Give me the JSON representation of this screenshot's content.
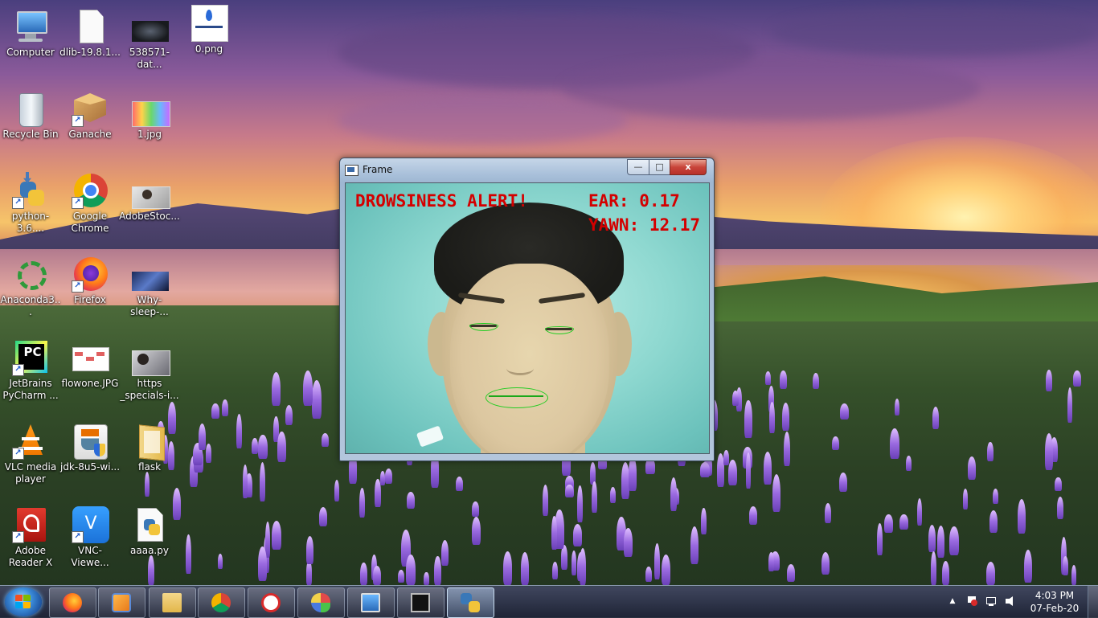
{
  "desktop": {
    "icons": [
      {
        "label": "Computer",
        "icon": "computer-icon"
      },
      {
        "label": "dlib-19.8.1...",
        "icon": "file-icon"
      },
      {
        "label": "538571-dat...",
        "icon": "image-file-icon"
      },
      {
        "label": "0.png",
        "icon": "image-file-icon"
      },
      {
        "label": "Recycle Bin",
        "icon": "recycle-bin-icon"
      },
      {
        "label": "Ganache",
        "icon": "ganache-icon"
      },
      {
        "label": "1.jpg",
        "icon": "image-file-icon"
      },
      {
        "label": "python-3.6....",
        "icon": "python-installer-icon"
      },
      {
        "label": "Google Chrome",
        "icon": "chrome-icon"
      },
      {
        "label": "AdobeStoc...",
        "icon": "image-file-icon"
      },
      {
        "label": "Anaconda3...",
        "icon": "anaconda-icon"
      },
      {
        "label": "Firefox",
        "icon": "firefox-icon"
      },
      {
        "label": "Why-sleep-...",
        "icon": "image-file-icon"
      },
      {
        "label": "JetBrains PyCharm ...",
        "icon": "pycharm-icon"
      },
      {
        "label": "flowone.JPG",
        "icon": "image-file-icon"
      },
      {
        "label": "https _specials-i...",
        "icon": "image-file-icon"
      },
      {
        "label": "VLC media player",
        "icon": "vlc-icon"
      },
      {
        "label": "jdk-8u5-wi...",
        "icon": "java-installer-icon"
      },
      {
        "label": "flask",
        "icon": "folder-icon"
      },
      {
        "label": "Adobe Reader X",
        "icon": "adobe-reader-icon"
      },
      {
        "label": "VNC-Viewe...",
        "icon": "vnc-icon"
      },
      {
        "label": "aaaa.py",
        "icon": "python-file-icon"
      }
    ]
  },
  "window": {
    "title": "Frame",
    "minimize_label": "—",
    "maximize_label": "□",
    "close_label": "x",
    "overlay": {
      "alert": "DROWSINESS ALERT!",
      "ear": "EAR: 0.17",
      "yawn": "YAWN: 12.17"
    }
  },
  "taskbar": {
    "start_icon": "windows-start-icon",
    "pinned": [
      "firefox-icon",
      "media-player-icon",
      "file-explorer-icon",
      "chrome-icon",
      "spider-app-icon",
      "paint-icon",
      "control-panel-icon",
      "command-prompt-icon",
      "python-icon"
    ],
    "clock_time": "4:03 PM",
    "clock_date": "07-Feb-20",
    "tray_up_arrow": "▲"
  },
  "colors": {
    "alert_red": "#d40000",
    "landmark_green": "#22cc22"
  }
}
